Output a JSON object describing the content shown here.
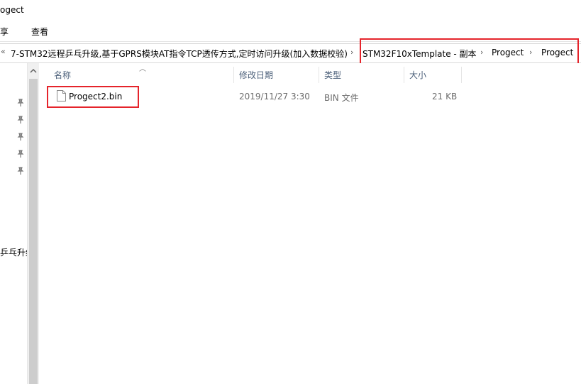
{
  "window": {
    "title": "ogect"
  },
  "ribbon": {
    "tabs": [
      "共享",
      "查看"
    ]
  },
  "address": {
    "overflow": "«",
    "segments": [
      "7-STM32远程乒乓升级,基于GPRS模块AT指令TCP透传方式,定时访问升级(加入数据校验)",
      "STM32F10xTemplate - 副本",
      "Progect",
      "Progect"
    ]
  },
  "nav": {
    "visible_text": "乒乓升级"
  },
  "columns": {
    "name": "名称",
    "date": "修改日期",
    "type": "类型",
    "size": "大小"
  },
  "files": [
    {
      "name": "Progect2.bin",
      "date": "2019/11/27 3:30",
      "type": "BIN 文件",
      "size": "21 KB"
    }
  ],
  "colors": {
    "highlight": "#e5242b",
    "header_text": "#4c607a"
  }
}
